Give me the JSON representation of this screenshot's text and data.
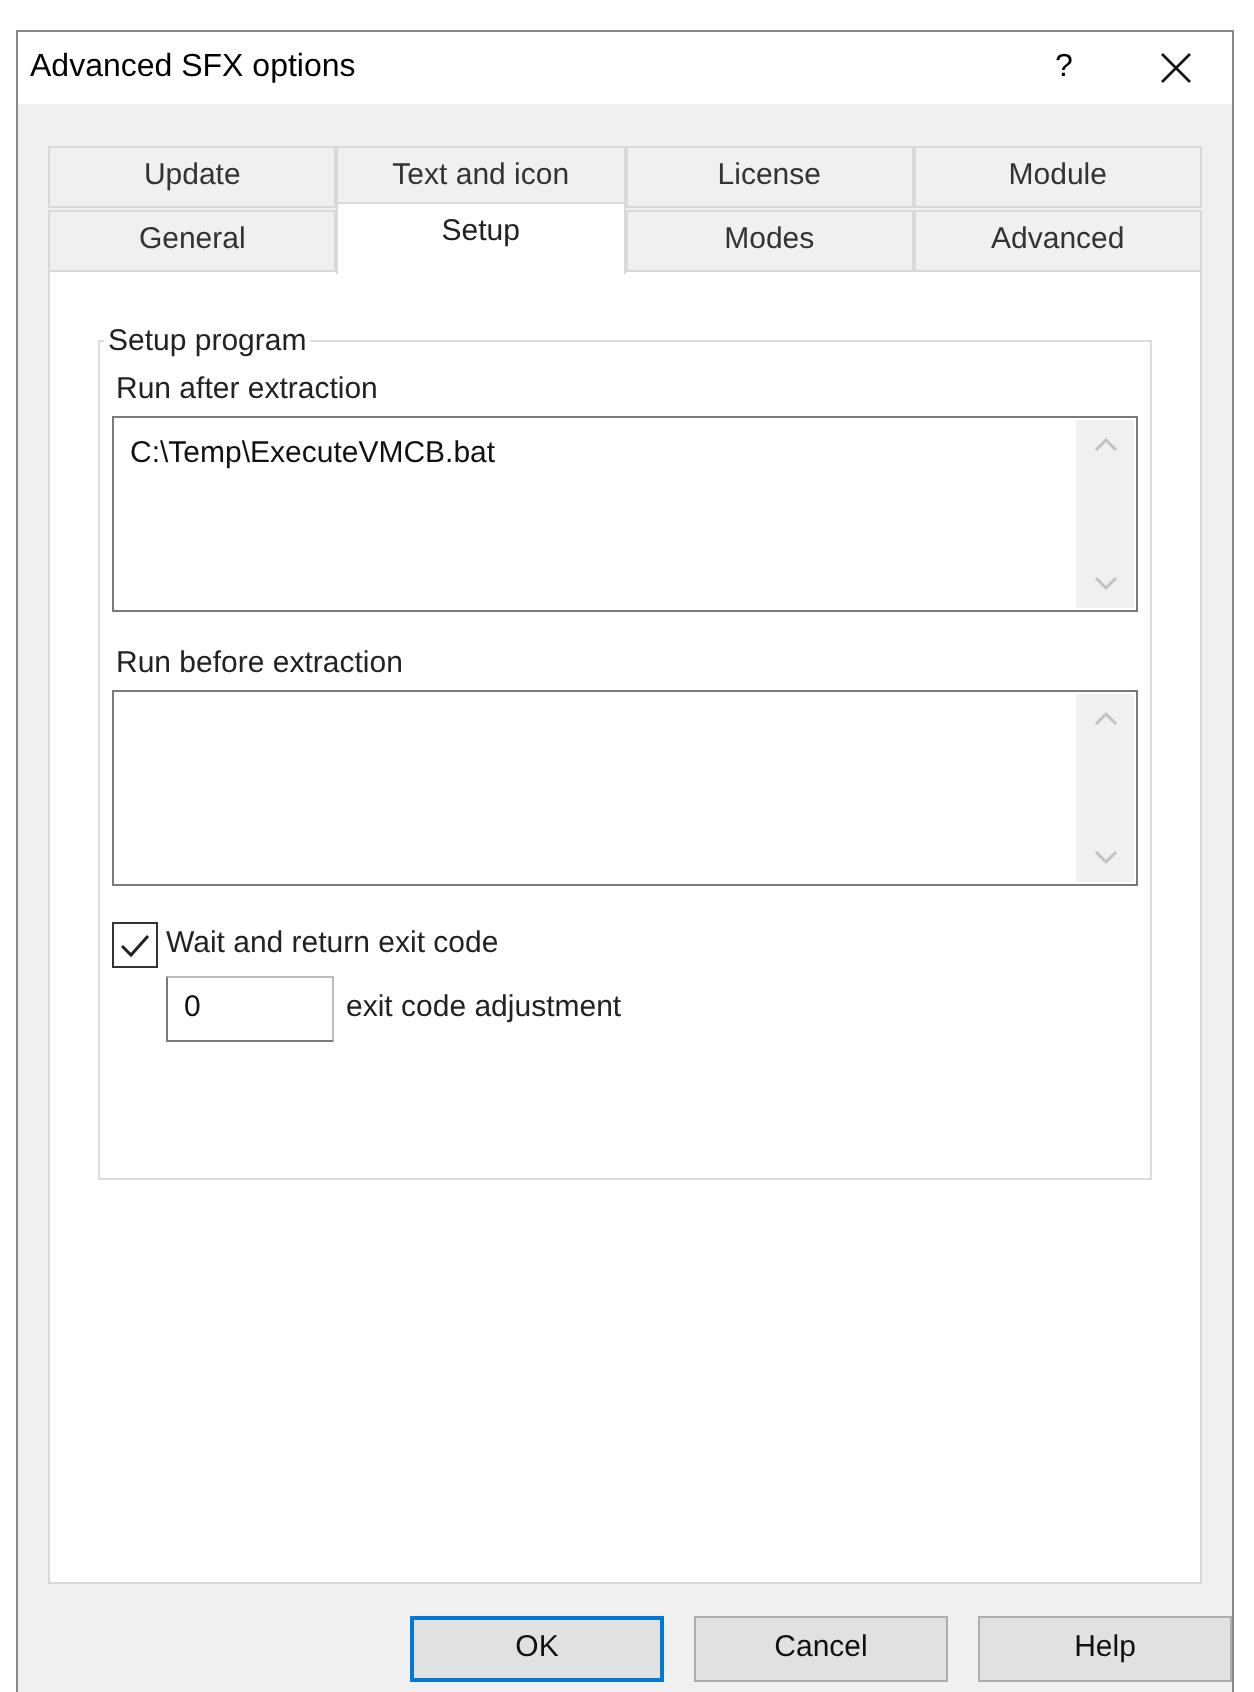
{
  "window": {
    "title": "Advanced SFX options",
    "help": "?"
  },
  "tab_rows": [
    [
      {
        "label": "Update",
        "selected": false
      },
      {
        "label": "Text and icon",
        "selected": false
      },
      {
        "label": "License",
        "selected": false
      },
      {
        "label": "Module",
        "selected": false
      }
    ],
    [
      {
        "label": "General",
        "selected": false
      },
      {
        "label": "Setup",
        "selected": true
      },
      {
        "label": "Modes",
        "selected": false
      },
      {
        "label": "Advanced",
        "selected": false
      }
    ]
  ],
  "group": {
    "title": "Setup program",
    "fields": [
      {
        "label": "Run after extraction",
        "value": "C:\\Temp\\ExecuteVMCB.bat"
      },
      {
        "label": "Run before extraction"
      }
    ],
    "wait_checkbox": {
      "label": "Wait and return exit code",
      "checked": true
    },
    "adjustment": {
      "value": "0",
      "label": "exit code adjustment"
    }
  },
  "buttons": [
    {
      "label": "OK",
      "default": true
    },
    {
      "label": "Cancel",
      "default": false
    },
    {
      "label": "Help",
      "default": false
    }
  ]
}
